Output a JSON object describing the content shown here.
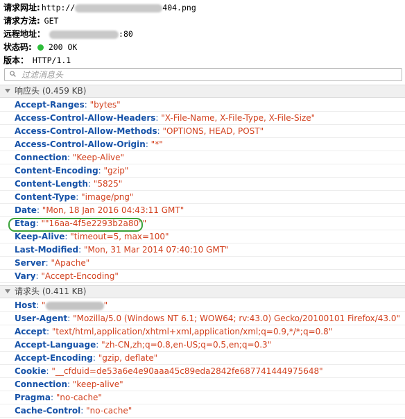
{
  "summary": {
    "url_label": "请求网址:",
    "url_prefix": "http://",
    "url_suffix": "404.png",
    "method_label": "请求方法:",
    "method_value": "GET",
    "remote_label": "远程地址：",
    "remote_port": ":80",
    "status_label": "状态码:",
    "status_value": "200 OK",
    "status_color": "#2dbd3a",
    "version_label": "版本：",
    "version_value": "HTTP/1.1"
  },
  "filter": {
    "placeholder": "过滤消息头",
    "icon": "search-icon"
  },
  "response": {
    "title": "响应头 (0.459 KB)",
    "headers": [
      {
        "name": "Accept-Ranges",
        "value": "\"bytes\""
      },
      {
        "name": "Access-Control-Allow-Headers",
        "value": "\"X-File-Name, X-File-Type, X-File-Size\""
      },
      {
        "name": "Access-Control-Allow-Methods",
        "value": "\"OPTIONS, HEAD, POST\""
      },
      {
        "name": "Access-Control-Allow-Origin",
        "value": "\"*\""
      },
      {
        "name": "Connection",
        "value": "\"Keep-Alive\""
      },
      {
        "name": "Content-Encoding",
        "value": "\"gzip\""
      },
      {
        "name": "Content-Length",
        "value": "\"5825\""
      },
      {
        "name": "Content-Type",
        "value": "\"image/png\""
      },
      {
        "name": "Date",
        "value": "\"Mon, 18 Jan 2016 04:43:11 GMT\""
      },
      {
        "name": "Etag",
        "value": "\"\"16aa-4f5e2293b2a80\"\"",
        "highlighted": true
      },
      {
        "name": "Keep-Alive",
        "value": "\"timeout=5, max=100\""
      },
      {
        "name": "Last-Modified",
        "value": "\"Mon, 31 Mar 2014 07:40:10 GMT\""
      },
      {
        "name": "Server",
        "value": "\"Apache\""
      },
      {
        "name": "Vary",
        "value": "\"Accept-Encoding\""
      }
    ]
  },
  "request": {
    "title": "请求头 (0.411 KB)",
    "host_name": "Host",
    "headers": [
      {
        "name": "User-Agent",
        "value": "\"Mozilla/5.0 (Windows NT 6.1; WOW64; rv:43.0) Gecko/20100101 Firefox/43.0\""
      },
      {
        "name": "Accept",
        "value": "\"text/html,application/xhtml+xml,application/xml;q=0.9,*/*;q=0.8\""
      },
      {
        "name": "Accept-Language",
        "value": "\"zh-CN,zh;q=0.8,en-US;q=0.5,en;q=0.3\""
      },
      {
        "name": "Accept-Encoding",
        "value": "\"gzip, deflate\""
      },
      {
        "name": "Cookie",
        "value": "\"__cfduid=de53a6e4e90aaa45c89eda2842fe687741444975648\""
      },
      {
        "name": "Connection",
        "value": "\"keep-alive\""
      },
      {
        "name": "Pragma",
        "value": "\"no-cache\""
      },
      {
        "name": "Cache-Control",
        "value": "\"no-cache\""
      }
    ]
  }
}
